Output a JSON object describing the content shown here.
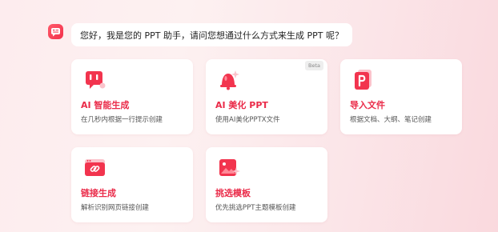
{
  "assistant": {
    "greeting": "您好，我是您的 PPT 助手，请问您想通过什么方式来生成 PPT 呢？"
  },
  "cards": {
    "ai_generate": {
      "title": "AI 智能生成",
      "desc": "在几秒内根据一行提示创建",
      "icon": "chat-bubble-icon"
    },
    "ai_beautify": {
      "title": "AI 美化 PPT",
      "desc": "使用AI美化PPTX文件",
      "icon": "bell-sparkle-icon",
      "badge": "Beta"
    },
    "import_file": {
      "title": "导入文件",
      "desc": "根据文档、大纲、笔记创建",
      "icon": "ppt-file-icon"
    },
    "link_generate": {
      "title": "链接生成",
      "desc": "解析识别网页链接创建",
      "icon": "link-icon"
    },
    "pick_template": {
      "title": "挑选模板",
      "desc": "优先挑选PPT主题模板创建",
      "icon": "image-sparkle-icon"
    }
  },
  "colors": {
    "accent": "#ea2b49",
    "icon_red": "#f2344e",
    "background": "#fdeef0"
  }
}
